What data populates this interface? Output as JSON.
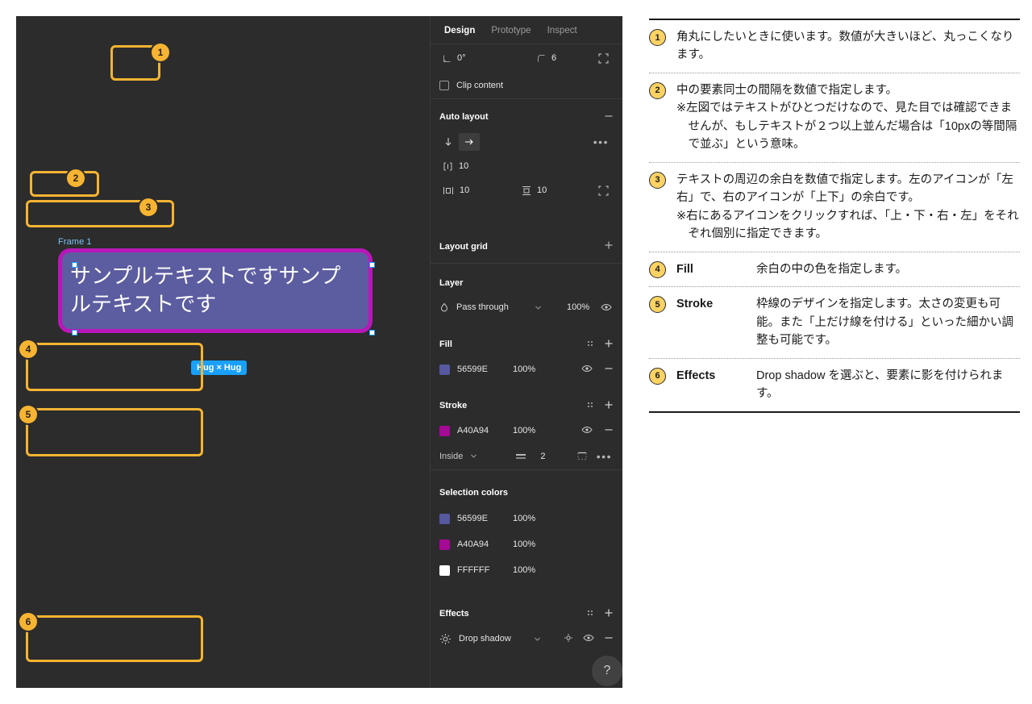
{
  "app": {
    "tabs": [
      {
        "label": "Design",
        "active": true
      },
      {
        "label": "Prototype",
        "active": false
      },
      {
        "label": "Inspect",
        "active": false
      }
    ]
  },
  "canvas": {
    "frame_label": "Frame 1",
    "frame_text": "サンプルテキストですサンプルテキストです",
    "size_badge": "Hug × Hug",
    "frame_fill": "#5C5CA0",
    "frame_stroke": "#B917B9"
  },
  "properties": {
    "rotation": {
      "icon": "rotation-icon",
      "value": "0°"
    },
    "corner_radius": {
      "icon": "corner-radius-icon",
      "value": "6"
    },
    "independent_corners_icon": "independent-corners-icon",
    "clip_content": {
      "label": "Clip content",
      "checked": false
    },
    "auto_layout": {
      "title": "Auto layout",
      "remove_icon": "minus-icon",
      "direction_vertical_icon": "arrow-down-icon",
      "direction_horizontal_icon": "arrow-right-icon",
      "more_icon": "ellipsis-icon",
      "gap": {
        "icon": "gap-spacing-icon",
        "value": "10"
      },
      "padding_horizontal": {
        "icon": "horizontal-padding-icon",
        "value": "10"
      },
      "padding_vertical": {
        "icon": "vertical-padding-icon",
        "value": "10"
      },
      "individual_padding_icon": "individual-padding-icon"
    },
    "layout_grid": {
      "title": "Layout grid",
      "add_icon": "plus-icon"
    },
    "layer": {
      "title": "Layer",
      "blend_icon": "blend-mode-icon",
      "blend_mode": "Pass through",
      "chevron_icon": "chevron-down-icon",
      "opacity": "100%",
      "visibility_icon": "eye-icon"
    },
    "fill": {
      "title": "Fill",
      "styles_icon": "styles-icon",
      "add_icon": "plus-icon",
      "items": [
        {
          "color": "#56599E",
          "hex": "56599E",
          "opacity": "100%",
          "visibility_icon": "eye-icon",
          "remove_icon": "minus-icon"
        }
      ]
    },
    "stroke": {
      "title": "Stroke",
      "styles_icon": "styles-icon",
      "add_icon": "plus-icon",
      "items": [
        {
          "color": "#A40A94",
          "hex": "A40A94",
          "opacity": "100%",
          "visibility_icon": "eye-icon",
          "remove_icon": "minus-icon"
        }
      ],
      "align": "Inside",
      "align_chevron_icon": "chevron-down-icon",
      "weight_icon": "stroke-weight-icon",
      "weight": "2",
      "per_side_icon": "stroke-per-side-icon",
      "advanced_icon": "ellipsis-icon"
    },
    "selection_colors": {
      "title": "Selection colors",
      "items": [
        {
          "color": "#56599E",
          "hex": "56599E",
          "opacity": "100%"
        },
        {
          "color": "#A40A94",
          "hex": "A40A94",
          "opacity": "100%"
        },
        {
          "color": "#FFFFFF",
          "hex": "FFFFFF",
          "opacity": "100%"
        }
      ]
    },
    "effects": {
      "title": "Effects",
      "styles_icon": "styles-icon",
      "add_icon": "plus-icon",
      "items": [
        {
          "type_icon": "effect-icon",
          "name": "Drop shadow",
          "chevron_icon": "chevron-down-icon",
          "settings_icon": "effect-settings-icon",
          "visibility_icon": "eye-icon",
          "remove_icon": "minus-icon"
        }
      ]
    }
  },
  "callouts": [
    {
      "n": "1"
    },
    {
      "n": "2"
    },
    {
      "n": "3"
    },
    {
      "n": "4"
    },
    {
      "n": "5"
    },
    {
      "n": "6"
    }
  ],
  "legend": {
    "items": [
      {
        "num": "1",
        "term": "",
        "lines": [
          {
            "text": "角丸にしたいときに使います。数値が大きいほど、丸っこくなります。",
            "indent": false
          }
        ]
      },
      {
        "num": "2",
        "term": "",
        "lines": [
          {
            "text": "中の要素同士の間隔を数値で指定します。",
            "indent": false
          },
          {
            "text": "※左図ではテキストがひとつだけなので、見た目では確認できませんが、もしテキストが２つ以上並んだ場合は「10pxの等間隔で並ぶ」という意味。",
            "indent": true
          }
        ]
      },
      {
        "num": "3",
        "term": "",
        "lines": [
          {
            "text": "テキストの周辺の余白を数値で指定します。左のアイコンが「左右」で、右のアイコンが「上下」の余白です。",
            "indent": false
          },
          {
            "text": "※右にあるアイコンをクリックすれば、「上・下・右・左」をそれぞれ個別に指定できます。",
            "indent": true
          }
        ]
      },
      {
        "num": "4",
        "term": "Fill",
        "lines": [
          {
            "text": "余白の中の色を指定します。",
            "indent": false
          }
        ]
      },
      {
        "num": "5",
        "term": "Stroke",
        "lines": [
          {
            "text": "枠線のデザインを指定します。太さの変更も可能。また「上だけ線を付ける」といった細かい調整も可能です。",
            "indent": false
          }
        ]
      },
      {
        "num": "6",
        "term": "Effects",
        "lines": [
          {
            "text": "Drop shadow を選ぶと、要素に影を付けられます。",
            "indent": false
          }
        ]
      }
    ]
  },
  "colors": {
    "highlight": "#F6B432",
    "badge_bg": "#FCD263",
    "panel_bg": "#2C2C2C",
    "accent_blue": "#18A0FB"
  }
}
